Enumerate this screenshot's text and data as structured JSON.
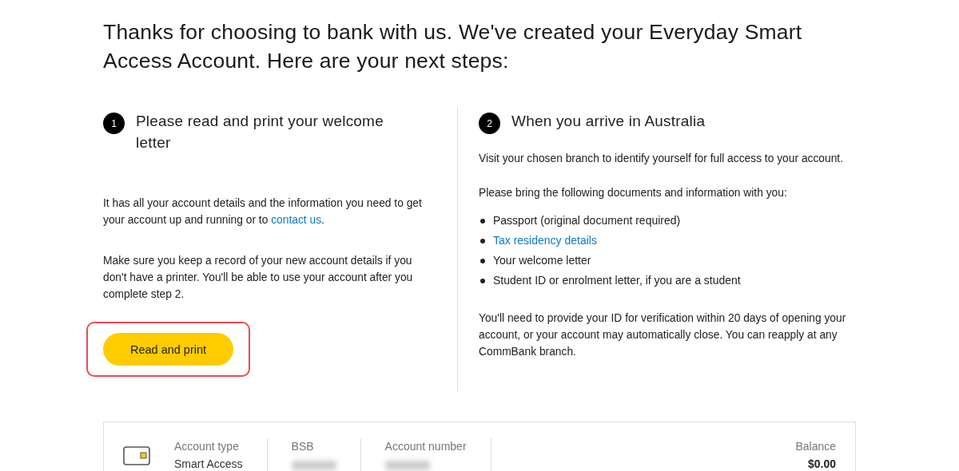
{
  "heading": "Thanks for choosing to bank with us. We've created your Everyday Smart Access Account. Here are your next steps:",
  "steps": [
    {
      "number": "1",
      "title": "Please read and print your welcome letter",
      "blocks": [
        {
          "kind": "paragraph",
          "parts": [
            {
              "kind": "text",
              "text": "It has all your account details and the information you need to get your account up and running or to "
            },
            {
              "kind": "link",
              "text": "contact us"
            },
            {
              "kind": "text",
              "text": "."
            }
          ]
        },
        {
          "kind": "paragraph",
          "parts": [
            {
              "kind": "text",
              "text": "Make sure you keep a record of your new account details if you don't have a printer. You'll be able to use your account after you complete step 2."
            }
          ]
        },
        {
          "kind": "button",
          "label": "Read and print",
          "highlighted": true
        }
      ]
    },
    {
      "number": "2",
      "title": "When you arrive in Australia",
      "blocks": [
        {
          "kind": "paragraph",
          "parts": [
            {
              "kind": "text",
              "text": "Visit your chosen branch to identify yourself for full access to your account."
            }
          ]
        },
        {
          "kind": "paragraph",
          "parts": [
            {
              "kind": "text",
              "text": "Please bring the following documents and information with you:"
            }
          ]
        },
        {
          "kind": "list",
          "items": [
            {
              "kind": "text",
              "text": "Passport (original document required)"
            },
            {
              "kind": "link",
              "text": "Tax residency details"
            },
            {
              "kind": "text",
              "text": "Your welcome letter"
            },
            {
              "kind": "text",
              "text": "Student ID or enrolment letter, if you are a student"
            }
          ]
        },
        {
          "kind": "paragraph",
          "parts": [
            {
              "kind": "text",
              "text": "You'll need to provide your ID for verification within 20 days of opening your account, or your account may automatically close. You can reapply at any CommBank branch."
            }
          ]
        }
      ]
    }
  ],
  "account": {
    "fields": [
      {
        "label": "Account type",
        "value": "Smart Access",
        "redacted": false
      },
      {
        "label": "BSB",
        "redacted": true
      },
      {
        "label": "Account number",
        "redacted": true
      }
    ],
    "balance": {
      "label": "Balance",
      "value": "$0.00"
    }
  }
}
